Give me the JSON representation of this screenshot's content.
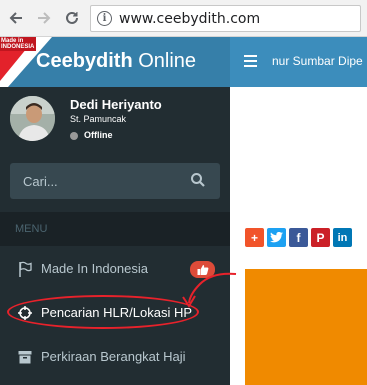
{
  "browser": {
    "url": "www.ceebydith.com"
  },
  "header": {
    "badge_text": "Made in INDONESIA",
    "logo_bold": "Ceebydith",
    "logo_rest": " Online",
    "marquee": "nur Sumbar Dipe"
  },
  "user": {
    "name": "Dedi Heriyanto",
    "subtitle": "St. Pamuncak",
    "status": "Offline"
  },
  "search": {
    "placeholder": "Cari..."
  },
  "menu": {
    "header": "MENU",
    "items": [
      {
        "label": "Made In Indonesia",
        "icon": "flag-icon"
      },
      {
        "label": "Pencarian HLR/Lokasi HP",
        "icon": "crosshairs-icon"
      },
      {
        "label": "Perkiraan Berangkat Haji",
        "icon": "archive-icon"
      }
    ]
  },
  "share": {
    "buttons": [
      {
        "label": "+",
        "color": "#f1542a",
        "icon": "plus-icon"
      },
      {
        "label": "t",
        "color": "#1da1f2",
        "icon": "twitter-icon"
      },
      {
        "label": "f",
        "color": "#3b5998",
        "icon": "facebook-icon"
      },
      {
        "label": "P",
        "color": "#cb2027",
        "icon": "pinterest-icon"
      },
      {
        "label": "in",
        "color": "#0077b5",
        "icon": "linkedin-icon"
      }
    ]
  },
  "colors": {
    "header_logo": "#367fa9",
    "header_bar": "#3c8dbc",
    "sidebar": "#222d32",
    "badge": "#dd4b39",
    "annotation": "#e8222b",
    "orange": "#f08a00"
  }
}
